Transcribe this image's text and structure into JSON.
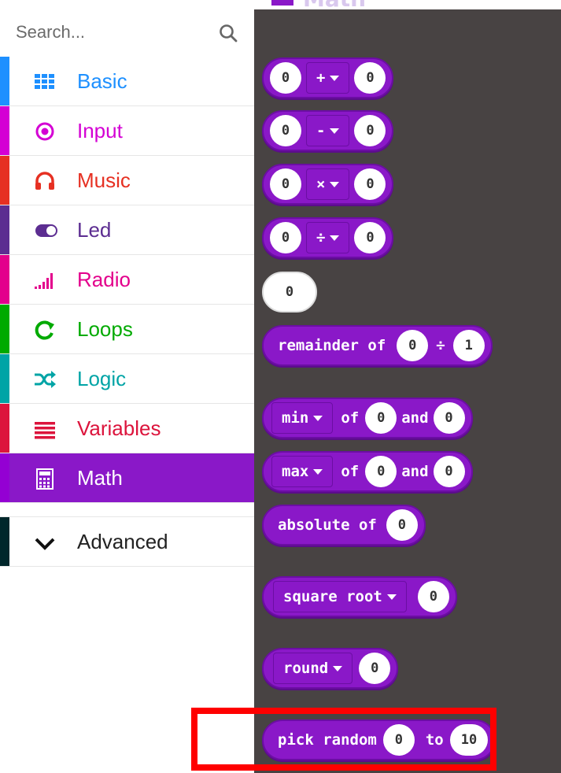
{
  "search": {
    "placeholder": "Search..."
  },
  "categories": [
    {
      "label": "Basic",
      "icon": "grid-icon",
      "color": "#1e90ff"
    },
    {
      "label": "Input",
      "icon": "radio-target-icon",
      "color": "#d400d4"
    },
    {
      "label": "Music",
      "icon": "headphones-icon",
      "color": "#e63022"
    },
    {
      "label": "Led",
      "icon": "toggle-icon",
      "color": "#5c2d91"
    },
    {
      "label": "Radio",
      "icon": "signal-bars-icon",
      "color": "#e3008c"
    },
    {
      "label": "Loops",
      "icon": "refresh-icon",
      "color": "#00aa00"
    },
    {
      "label": "Logic",
      "icon": "shuffle-icon",
      "color": "#00a4a6"
    },
    {
      "label": "Variables",
      "icon": "list-icon",
      "color": "#dc143c"
    },
    {
      "label": "Math",
      "icon": "calculator-icon",
      "color": "#9400d3",
      "active": true
    },
    {
      "label": "Advanced",
      "icon": "chevron-down-icon",
      "color": "#00272b"
    }
  ],
  "flyout": {
    "title": "Math",
    "blocks": {
      "add": {
        "left": "0",
        "op": "+",
        "right": "0"
      },
      "subtract": {
        "left": "0",
        "op": "-",
        "right": "0"
      },
      "multiply": {
        "left": "0",
        "op": "×",
        "right": "0"
      },
      "divide": {
        "left": "0",
        "op": "÷",
        "right": "0"
      },
      "number": {
        "value": "0"
      },
      "remainder": {
        "label": "remainder of",
        "left": "0",
        "op": "÷",
        "right": "1"
      },
      "min": {
        "fn": "min",
        "of": "of",
        "a": "0",
        "and": "and",
        "b": "0"
      },
      "max": {
        "fn": "max",
        "of": "of",
        "a": "0",
        "and": "and",
        "b": "0"
      },
      "absolute": {
        "label": "absolute of",
        "value": "0"
      },
      "sqrt": {
        "fn": "square root",
        "value": "0"
      },
      "round": {
        "fn": "round",
        "value": "0"
      },
      "random": {
        "label": "pick random",
        "from": "0",
        "to_label": "to",
        "to": "10"
      }
    }
  },
  "colors": {
    "accent": "#8a18c8",
    "flyout_bg": "#484343",
    "highlight": "#ff0000"
  }
}
